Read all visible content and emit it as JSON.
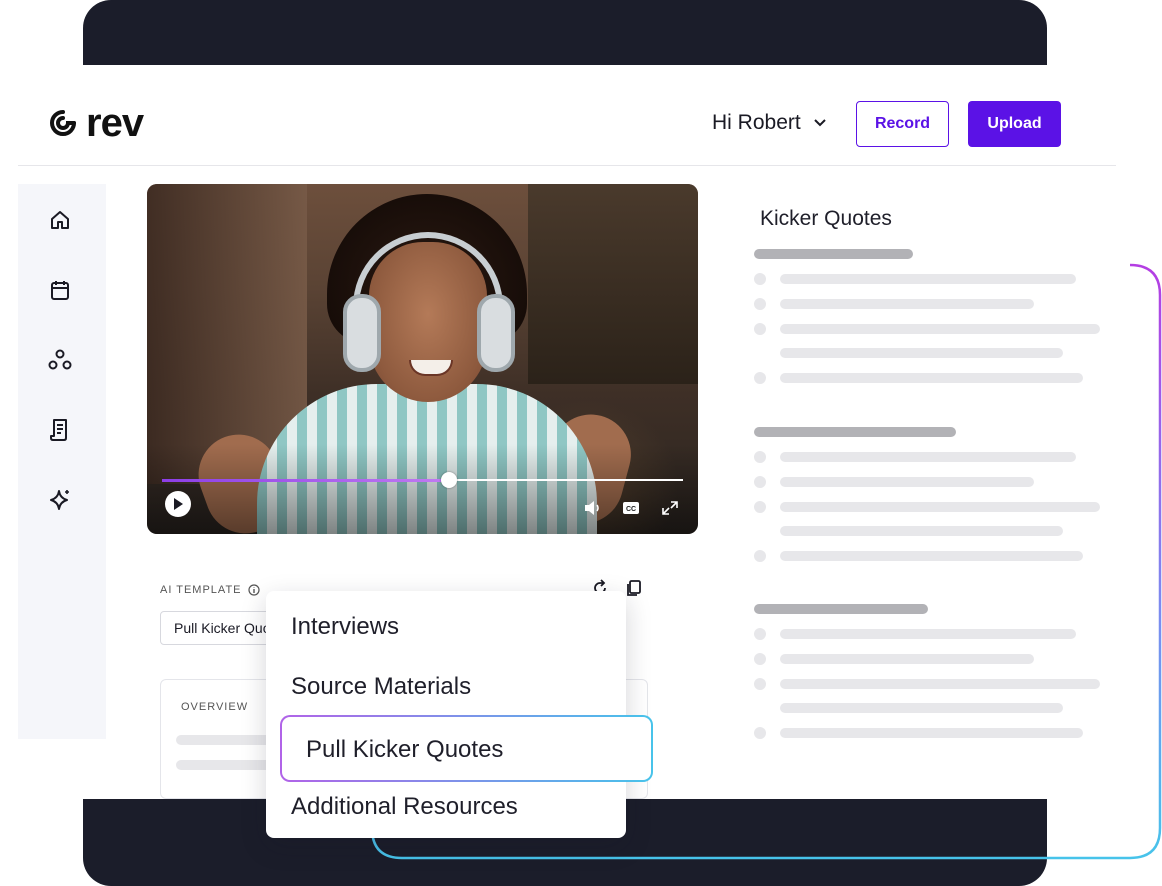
{
  "brand": {
    "logo_text": "rev"
  },
  "header": {
    "greeting": "Hi Robert",
    "record_label": "Record",
    "upload_label": "Upload"
  },
  "sidebar": {
    "items": [
      {
        "icon": "home-icon"
      },
      {
        "icon": "calendar-icon"
      },
      {
        "icon": "people-icon"
      },
      {
        "icon": "document-icon"
      },
      {
        "icon": "sparkle-icon"
      }
    ]
  },
  "video": {
    "progress": 0.55,
    "controls": [
      "play-icon",
      "volume-icon",
      "cc-icon",
      "fullscreen-icon"
    ],
    "cc_label": "CC"
  },
  "ai_template": {
    "label": "AI TEMPLATE",
    "selected_value": "Pull Kicker Quotes"
  },
  "overview": {
    "label": "OVERVIEW"
  },
  "dropdown": {
    "items": [
      "Interviews",
      "Source Materials",
      "Pull Kicker Quotes",
      "Additional Resources"
    ],
    "selected_index": 2
  },
  "kicker": {
    "title": "Kicker Quotes"
  },
  "colors": {
    "accent": "#5b12e6",
    "dark_band": "#1b1d2a",
    "gradient_start": "#b163e8",
    "gradient_end": "#47c3ea"
  }
}
